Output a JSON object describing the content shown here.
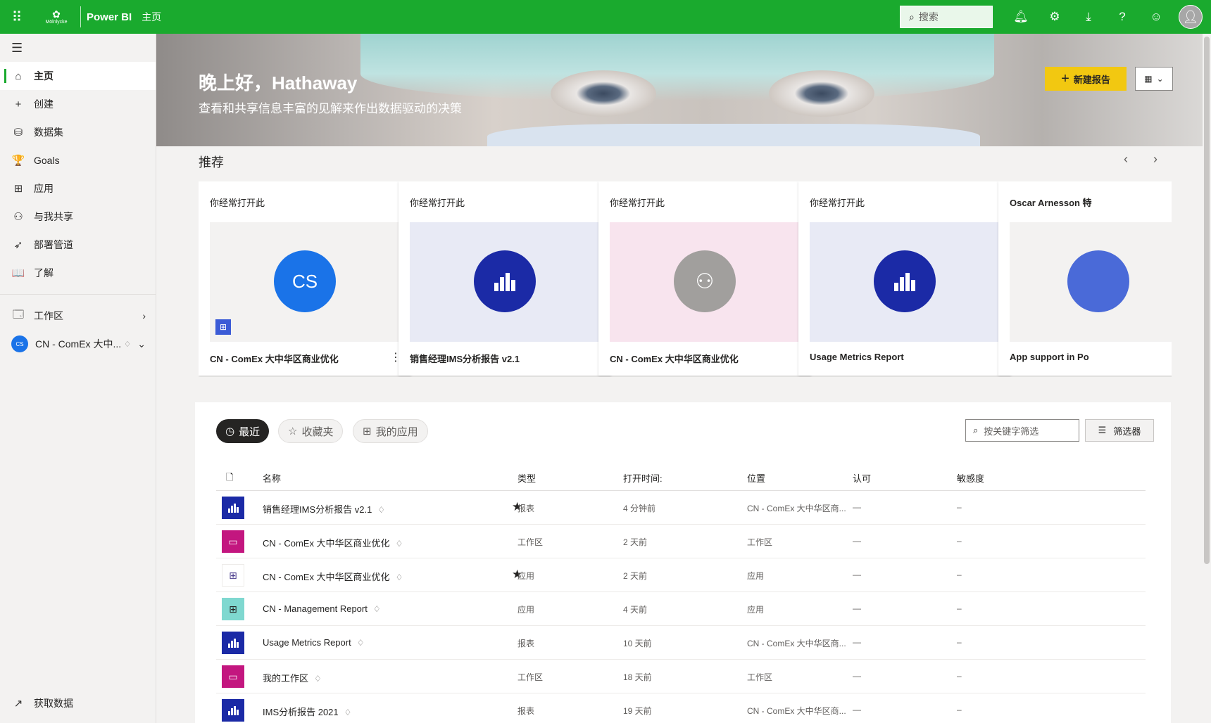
{
  "topbar": {
    "logo_text": "Mölnlycke",
    "app_name": "Power BI",
    "breadcrumb": "主页",
    "search_placeholder": "搜索"
  },
  "sidebar": {
    "items": [
      {
        "label": "主页",
        "icon": "home-icon",
        "glyph": "⌂"
      },
      {
        "label": "创建",
        "icon": "plus-icon",
        "glyph": "+"
      },
      {
        "label": "数据集",
        "icon": "database-icon",
        "glyph": "⛁"
      },
      {
        "label": "Goals",
        "icon": "trophy-icon",
        "glyph": "🏆"
      },
      {
        "label": "应用",
        "icon": "apps-icon",
        "glyph": "⊞"
      },
      {
        "label": "与我共享",
        "icon": "share-icon",
        "glyph": "⚇"
      },
      {
        "label": "部署管道",
        "icon": "rocket-icon",
        "glyph": "➶"
      },
      {
        "label": "了解",
        "icon": "book-icon",
        "glyph": "📖"
      }
    ],
    "workspaces_label": "工作区",
    "current_workspace": "CN - ComEx 大中...",
    "current_workspace_badge": "CS",
    "get_data": "获取数据"
  },
  "hero": {
    "greeting": "晚上好，Hathaway",
    "subtitle": "查看和共享信息丰富的见解来作出数据驱动的决策",
    "new_report": "新建报告"
  },
  "recommended": {
    "title": "推荐",
    "cards": [
      {
        "reason": "你经常打开此",
        "name": "CN - ComEx 大中华区商业优化",
        "thumb_bg": "#f3f2f1",
        "circle_bg": "#1a73e8",
        "circle_text": "CS",
        "kind": "workspace"
      },
      {
        "reason": "你经常打开此",
        "name": "销售经理IMS分析报告 v2.1",
        "thumb_bg": "#e8eaf5",
        "circle_bg": "#1b2aa6",
        "circle_text": "",
        "kind": "report"
      },
      {
        "reason": "你经常打开此",
        "name": "CN - ComEx 大中华区商业优化",
        "thumb_bg": "#f8e4ee",
        "circle_bg": "#a19f9d",
        "circle_text": "",
        "kind": "group"
      },
      {
        "reason": "你经常打开此",
        "name": "Usage Metrics Report",
        "thumb_bg": "#e8eaf5",
        "circle_bg": "#1b2aa6",
        "circle_text": "",
        "kind": "report"
      },
      {
        "reason": "Oscar Arnesson 特",
        "name": "App support in Po",
        "thumb_bg": "#f3f2f1",
        "circle_bg": "#4a6ad8",
        "circle_text": "",
        "kind": "partial"
      }
    ]
  },
  "recent": {
    "tabs": [
      "最近",
      "收藏夹",
      "我的应用"
    ],
    "filter_placeholder": "按关键字筛选",
    "filter_button": "筛选器",
    "columns": [
      "名称",
      "类型",
      "打开时间:",
      "位置",
      "认可",
      "敏感度"
    ],
    "rows": [
      {
        "name": "销售经理IMS分析报告 v2.1",
        "starred": true,
        "type": "报表",
        "opened": "4 分钟前",
        "location": "CN - ComEx 大中华区商...",
        "endorsement": "—",
        "sensitivity": "–",
        "icon_bg": "#1b2aa6",
        "icon": "report-icon",
        "glyph": "▮"
      },
      {
        "name": "CN - ComEx 大中华区商业优化",
        "starred": false,
        "type": "工作区",
        "opened": "2 天前",
        "location": "工作区",
        "endorsement": "—",
        "sensitivity": "–",
        "icon_bg": "#c3167f",
        "icon": "workspace-icon",
        "glyph": "▭"
      },
      {
        "name": "CN - ComEx 大中华区商业优化",
        "starred": true,
        "type": "应用",
        "opened": "2 天前",
        "location": "应用",
        "endorsement": "—",
        "sensitivity": "–",
        "icon_bg": "#ffffff",
        "icon": "app-icon",
        "glyph": "⊞"
      },
      {
        "name": "CN - Management Report",
        "starred": false,
        "type": "应用",
        "opened": "4 天前",
        "location": "应用",
        "endorsement": "—",
        "sensitivity": "–",
        "icon_bg": "#7fd8d0",
        "icon": "app-icon",
        "glyph": "⊞"
      },
      {
        "name": "Usage Metrics Report",
        "starred": false,
        "type": "报表",
        "opened": "10 天前",
        "location": "CN - ComEx 大中华区商...",
        "endorsement": "—",
        "sensitivity": "–",
        "icon_bg": "#1b2aa6",
        "icon": "report-icon",
        "glyph": "▮"
      },
      {
        "name": "我的工作区",
        "starred": false,
        "type": "工作区",
        "opened": "18 天前",
        "location": "工作区",
        "endorsement": "—",
        "sensitivity": "–",
        "icon_bg": "#c3167f",
        "icon": "workspace-icon",
        "glyph": "▭"
      },
      {
        "name": "IMS分析报告 2021",
        "starred": false,
        "type": "报表",
        "opened": "19 天前",
        "location": "CN - ComEx 大中华区商...",
        "endorsement": "—",
        "sensitivity": "–",
        "icon_bg": "#1b2aa6",
        "icon": "report-icon",
        "glyph": "▮"
      }
    ]
  },
  "colors": {
    "brand": "#1aaa2e",
    "accent_button": "#f2c811"
  }
}
